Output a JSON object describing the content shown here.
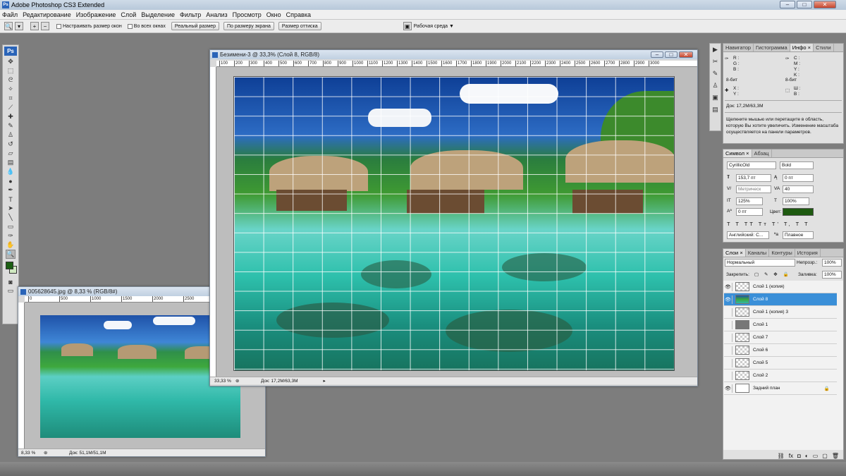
{
  "app": {
    "title": "Adobe Photoshop CS3 Extended",
    "logo": "Ps"
  },
  "window_controls": {
    "minimize": "–",
    "maximize": "□",
    "close": "✕"
  },
  "menu": [
    "Файл",
    "Редактирование",
    "Изображение",
    "Слой",
    "Выделение",
    "Фильтр",
    "Анализ",
    "Просмотр",
    "Окно",
    "Справка"
  ],
  "options": {
    "resize_windows": "Настраивать размер окон",
    "all_windows": "Во всех окнах",
    "actual_pixels": "Реальный размер",
    "fit_screen": "По размеру экрана",
    "print_size": "Размер оттиска",
    "workspace": "Рабочая среда ▼"
  },
  "doc_main": {
    "title": "Безимени-3 @ 33,3% (Слой 8, RGB/8)",
    "ruler": [
      "100",
      "200",
      "300",
      "400",
      "500",
      "600",
      "700",
      "800",
      "900",
      "1000",
      "1100",
      "1200",
      "1300",
      "1400",
      "1500",
      "1600",
      "1700",
      "1800",
      "1900",
      "2000",
      "2100",
      "2200",
      "2300",
      "2400",
      "2500",
      "2600",
      "2700",
      "2800",
      "2900",
      "3000"
    ],
    "zoom": "33,33 %",
    "doc_size": "Док: 17,2M/63,3M"
  },
  "doc_small": {
    "title": "005628645.jpg @ 8,33 % (RGB/8#)",
    "ruler": [
      "0",
      "500",
      "1000",
      "1500",
      "2000",
      "2500",
      "3000",
      "3500",
      "4000"
    ],
    "zoom": "8,33 %",
    "doc_size": "Док: 51,1M/51,1M"
  },
  "panel_info": {
    "tabs": [
      "Навигатор",
      "Гистограмма",
      "Инфо ×",
      "Стили"
    ],
    "rgb": [
      "R :",
      "G :",
      "B :"
    ],
    "cmyk": [
      "C :",
      "M :",
      "Y :",
      "K :"
    ],
    "bit_left": "8-бит",
    "bit_right": "8-бит",
    "xy": [
      "X :",
      "Y :"
    ],
    "wh": [
      "Ш :",
      "В :"
    ],
    "doc": "Док: 17,2M/63,3M",
    "hint": "Щелкните мышью или перетащите в область, которую Вы хотите увеличить. Изменение масштаба осуществляется на панели параметров."
  },
  "panel_char": {
    "tabs": [
      "Символ ×",
      "Абзац"
    ],
    "font": "CyrillicOld",
    "style": "Bold",
    "size": "153,7 пт",
    "leading": "0 пт",
    "kerning": "Метрическ",
    "tracking": "40",
    "vscale": "125%",
    "hscale": "100%",
    "baseline": "0 пт",
    "color_label": "Цвет:",
    "color": "#1e5a10",
    "language": "Английский: С...",
    "aa_label": "ªa",
    "antialias": "Плавное"
  },
  "panel_layers": {
    "tabs": [
      "Слои ×",
      "Каналы",
      "Контуры",
      "История"
    ],
    "blend": "Нормальный",
    "opacity_label": "Непрозр.:",
    "opacity": "100%",
    "lock_label": "Закрепить:",
    "fill_label": "Заливка:",
    "fill": "100%",
    "layers": [
      {
        "name": "Слой 1 (копия)",
        "visible": true,
        "selected": false
      },
      {
        "name": "Слой 8",
        "visible": true,
        "selected": true
      },
      {
        "name": "Слой 1 (копия) 3",
        "visible": false,
        "selected": false
      },
      {
        "name": "Слой 1",
        "visible": false,
        "selected": false
      },
      {
        "name": "Слой 7",
        "visible": false,
        "selected": false
      },
      {
        "name": "Слой 6",
        "visible": false,
        "selected": false
      },
      {
        "name": "Слой 5",
        "visible": false,
        "selected": false
      },
      {
        "name": "Слой 2",
        "visible": false,
        "selected": false
      },
      {
        "name": "Задний план",
        "visible": true,
        "selected": false
      }
    ],
    "footer_icons": [
      "link-icon",
      "fx-icon",
      "mask-icon",
      "adjustment-icon",
      "folder-icon",
      "new-layer-icon",
      "trash-icon"
    ]
  },
  "colors": {
    "foreground": "#1b5e12",
    "background": "#cfe8c0",
    "accent": "#3a8fd8"
  }
}
